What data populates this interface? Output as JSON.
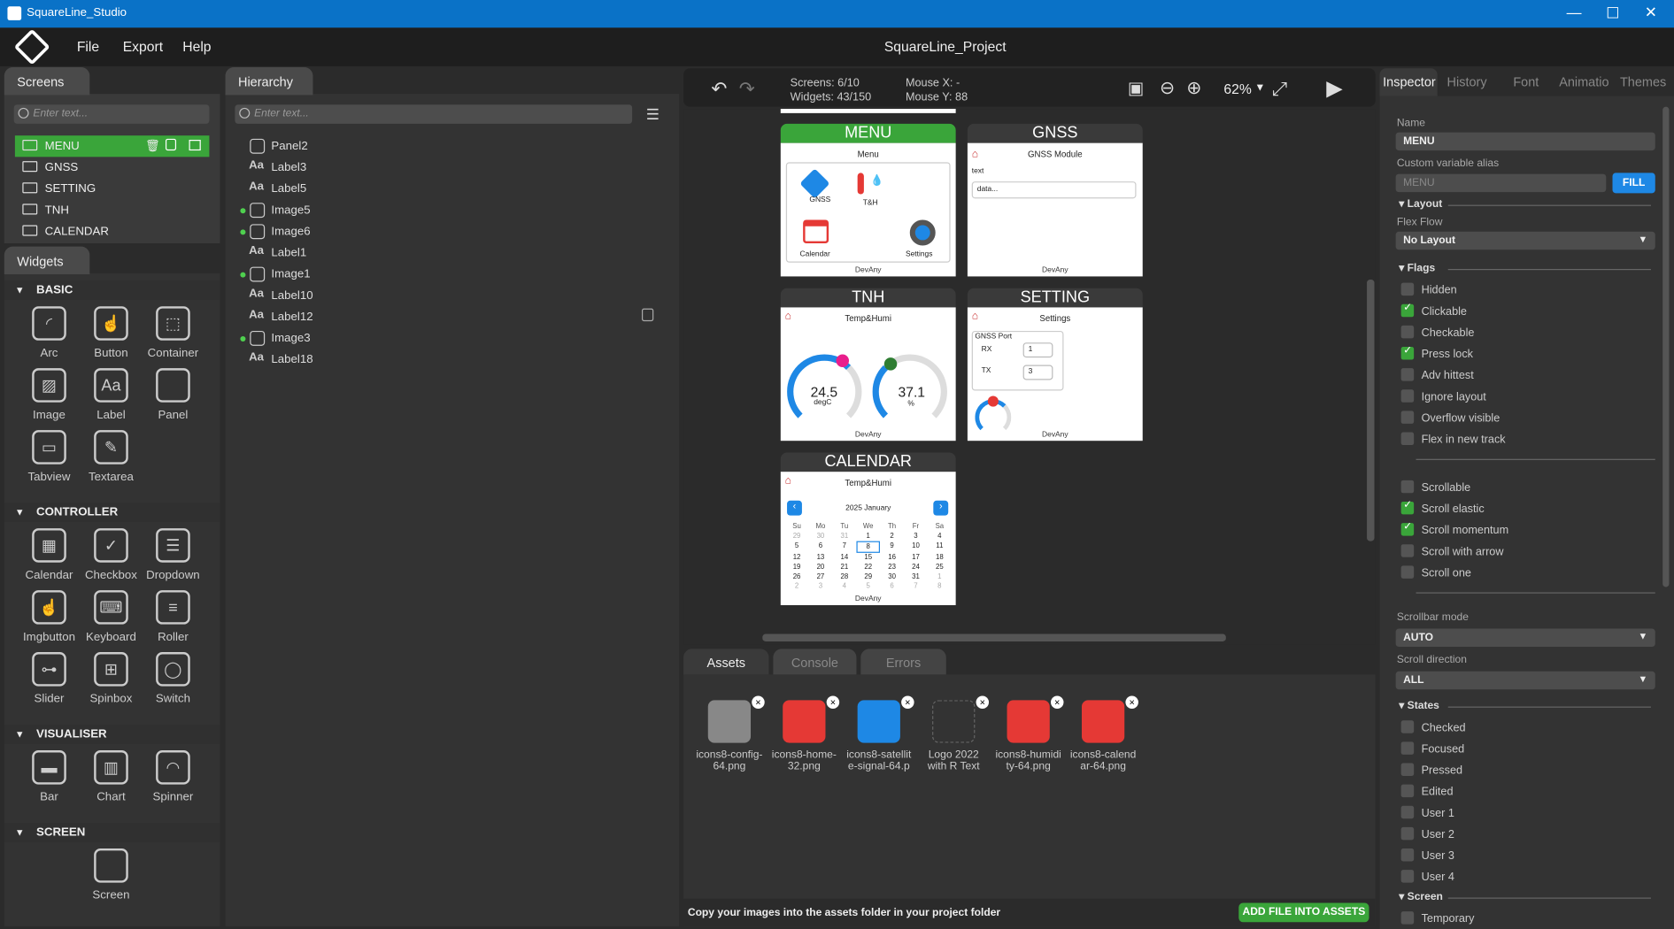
{
  "window": {
    "title": "SquareLine_Studio",
    "project": "SquareLine_Project"
  },
  "menu": [
    "File",
    "Export",
    "Help"
  ],
  "screens": {
    "tab": "Screens",
    "search_placeholder": "Enter text...",
    "items": [
      "MENU",
      "GNSS",
      "SETTING",
      "TNH",
      "CALENDAR"
    ]
  },
  "widgets": {
    "tab": "Widgets",
    "sections": [
      {
        "title": "BASIC",
        "items": [
          "Arc",
          "Button",
          "Container",
          "Image",
          "Label",
          "Panel",
          "Tabview",
          "Textarea"
        ]
      },
      {
        "title": "CONTROLLER",
        "items": [
          "Calendar",
          "Checkbox",
          "Dropdown",
          "Imgbutton",
          "Keyboard",
          "Roller",
          "Slider",
          "Spinbox",
          "Switch"
        ]
      },
      {
        "title": "VISUALISER",
        "items": [
          "Bar",
          "Chart",
          "Spinner"
        ]
      },
      {
        "title": "SCREEN",
        "items": [
          "Screen"
        ]
      }
    ]
  },
  "hierarchy": {
    "tab": "Hierarchy",
    "search_placeholder": "Enter text...",
    "items": [
      {
        "name": "Panel2",
        "kind": "panel"
      },
      {
        "name": "Label3",
        "kind": "label"
      },
      {
        "name": "Label5",
        "kind": "label"
      },
      {
        "name": "Image5",
        "kind": "image"
      },
      {
        "name": "Image6",
        "kind": "image"
      },
      {
        "name": "Label1",
        "kind": "label"
      },
      {
        "name": "Image1",
        "kind": "image"
      },
      {
        "name": "Label10",
        "kind": "label"
      },
      {
        "name": "Label12",
        "kind": "label"
      },
      {
        "name": "Image3",
        "kind": "image"
      },
      {
        "name": "Label18",
        "kind": "label"
      }
    ]
  },
  "toolbar": {
    "screens": "Screens: 6/10",
    "widgets": "Widgets: 43/150",
    "mouse_x": "Mouse X:  -",
    "mouse_y": "Mouse Y:  88",
    "zoom": "62%"
  },
  "canvas": {
    "menu": {
      "title": "MENU",
      "sub": "Menu",
      "items": [
        "GNSS",
        "T&H",
        "Calendar",
        "Settings"
      ],
      "footer": "DevAny"
    },
    "gnss": {
      "title": "GNSS",
      "sub": "GNSS Module",
      "label": "text",
      "field": "data...",
      "footer": "DevAny"
    },
    "tnh": {
      "title": "TNH",
      "sub": "Temp&Humi",
      "v1": "24.5",
      "u1": "degC",
      "v2": "37.1",
      "u2": "%",
      "footer": "DevAny"
    },
    "setting": {
      "title": "SETTING",
      "sub": "Settings",
      "port": "GNSS Port",
      "rx": "RX",
      "rxv": "1",
      "tx": "TX",
      "txv": "3",
      "footer": "DevAny"
    },
    "calendar": {
      "title": "CALENDAR",
      "sub": "Temp&Humi",
      "month": "2025 January",
      "days": [
        "Su",
        "Mo",
        "Tu",
        "We",
        "Th",
        "Fr",
        "Sa"
      ],
      "rows": [
        [
          "29",
          "30",
          "31",
          "1",
          "2",
          "3",
          "4"
        ],
        [
          "5",
          "6",
          "7",
          "8",
          "9",
          "10",
          "11"
        ],
        [
          "12",
          "13",
          "14",
          "15",
          "16",
          "17",
          "18"
        ],
        [
          "19",
          "20",
          "21",
          "22",
          "23",
          "24",
          "25"
        ],
        [
          "26",
          "27",
          "28",
          "29",
          "30",
          "31",
          "1"
        ],
        [
          "2",
          "3",
          "4",
          "5",
          "6",
          "7",
          "8"
        ]
      ],
      "footer": "DevAny"
    }
  },
  "bottom": {
    "tabs": [
      "Assets",
      "Console",
      "Errors"
    ],
    "hint": "Copy your images into the assets folder in your project folder",
    "add_button": "ADD FILE INTO ASSETS",
    "assets": [
      "icons8-config-64.png",
      "icons8-home-32.png",
      "icons8-satellit e-signal-64.p",
      "Logo 2022 with R Text",
      "icons8-humidi ty-64.png",
      "icons8-calend ar-64.png"
    ]
  },
  "inspector": {
    "tabs": [
      "Inspector",
      "History",
      "Font",
      "Animatio",
      "Themes"
    ],
    "name_label": "Name",
    "name": "MENU",
    "alias_label": "Custom variable alias",
    "alias_placeholder": "MENU",
    "fill": "FILL",
    "layout": "Layout",
    "flex_flow": "Flex Flow",
    "flex_value": "No Layout",
    "flags": "Flags",
    "flag_items": [
      {
        "l": "Hidden",
        "on": false
      },
      {
        "l": "Clickable",
        "on": true
      },
      {
        "l": "Checkable",
        "on": false
      },
      {
        "l": "Press lock",
        "on": true
      },
      {
        "l": "Adv hittest",
        "on": false
      },
      {
        "l": "Ignore layout",
        "on": false
      },
      {
        "l": "Overflow visible",
        "on": false
      },
      {
        "l": "Flex in new track",
        "on": false
      }
    ],
    "scroll_items": [
      {
        "l": "Scrollable",
        "on": false
      },
      {
        "l": "Scroll elastic",
        "on": true
      },
      {
        "l": "Scroll momentum",
        "on": true
      },
      {
        "l": "Scroll with arrow",
        "on": false
      },
      {
        "l": "Scroll one",
        "on": false
      }
    ],
    "scrollbar_mode": "Scrollbar mode",
    "scrollbar_value": "AUTO",
    "scroll_dir": "Scroll direction",
    "scroll_dir_value": "ALL",
    "states": "States",
    "state_items": [
      "Checked",
      "Focused",
      "Pressed",
      "Edited",
      "User 1",
      "User 2",
      "User 3",
      "User 4"
    ],
    "screen": "Screen",
    "screen_items": [
      "Temporary"
    ]
  },
  "colors": {
    "accent": "#3aa53a",
    "titlebar": "#0a72c7",
    "fill": "#1e88e5"
  }
}
